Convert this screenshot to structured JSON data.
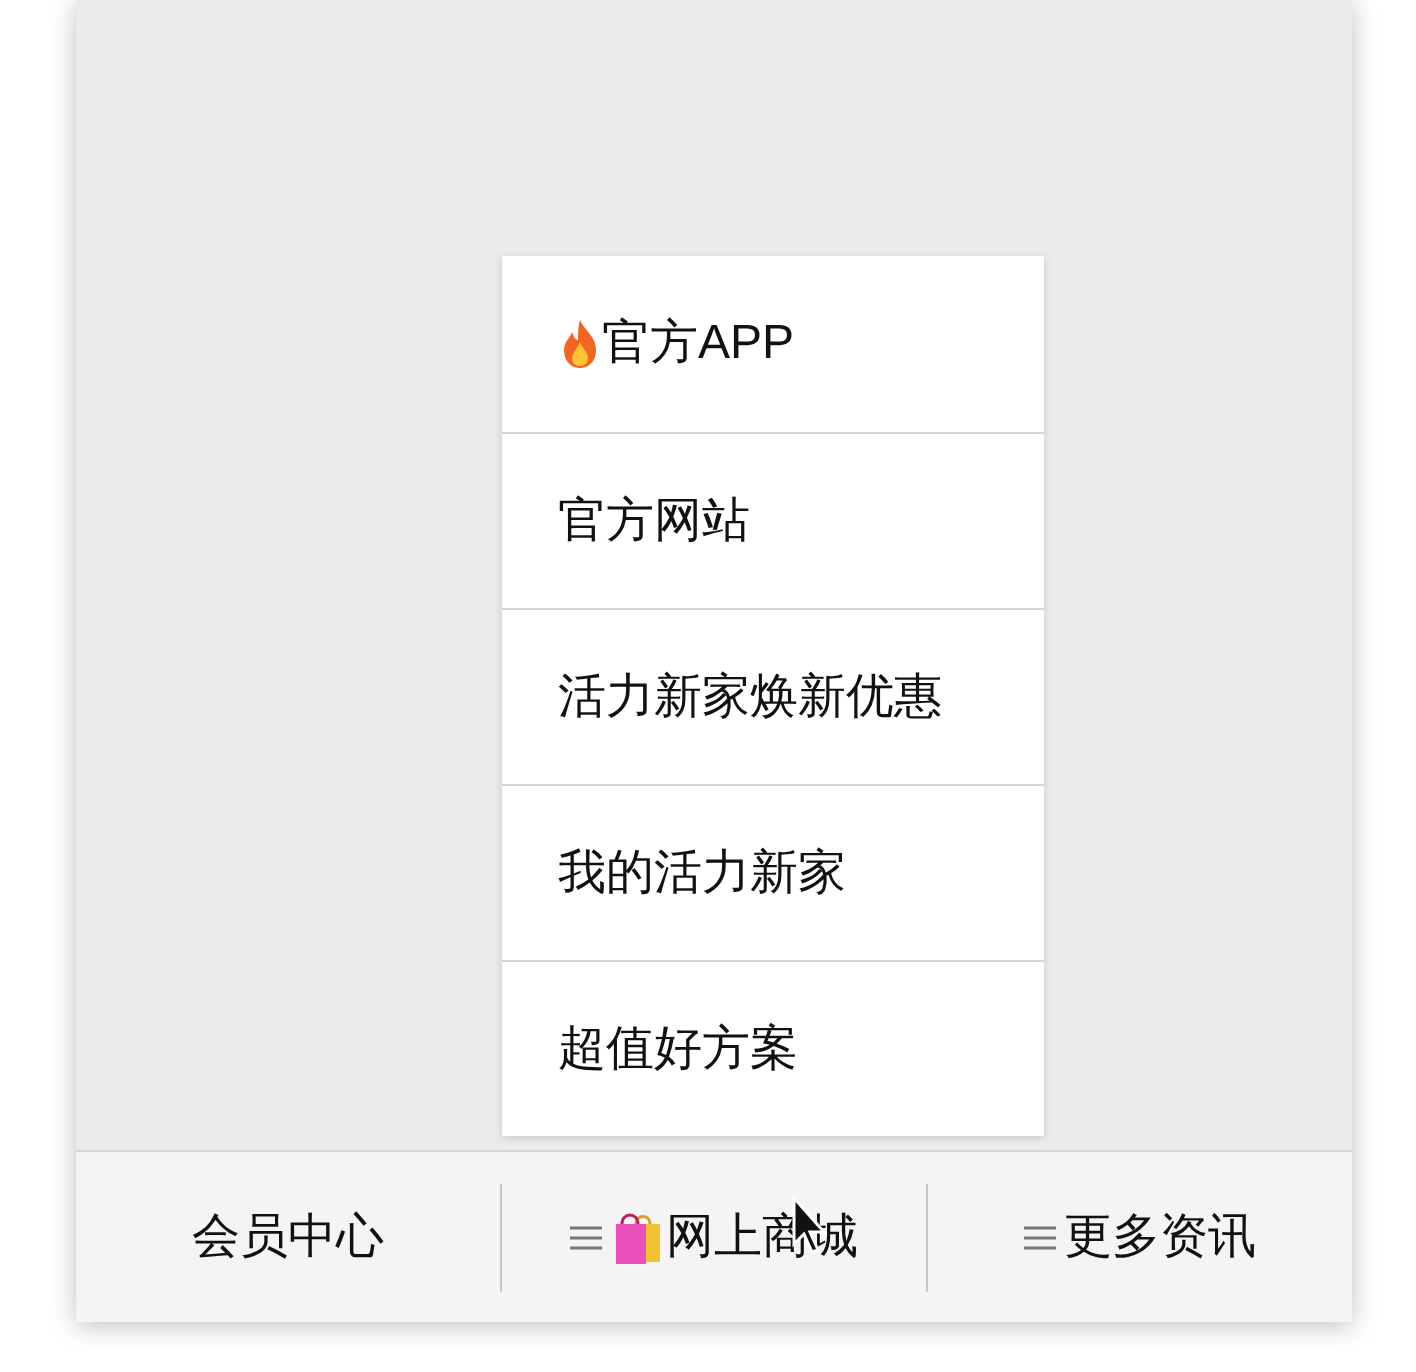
{
  "popup_menu": {
    "items": [
      {
        "label": "官方APP"
      },
      {
        "label": "官方网站"
      },
      {
        "label": "活力新家焕新优惠"
      },
      {
        "label": "我的活力新家"
      },
      {
        "label": "超值好方案"
      }
    ]
  },
  "bottom_bar": {
    "tabs": [
      {
        "label": "会员中心",
        "menu": false
      },
      {
        "label": "网上商城",
        "menu": true
      },
      {
        "label": "更多资讯",
        "menu": true
      }
    ]
  }
}
